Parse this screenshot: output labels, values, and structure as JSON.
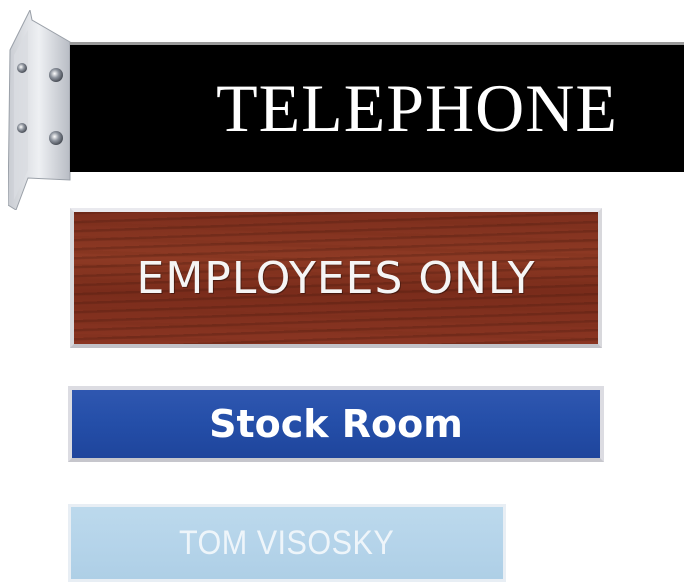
{
  "signs": {
    "telephone": {
      "text": "TELEPHONE",
      "background": "#000000",
      "text_color": "#ffffff"
    },
    "employees": {
      "text": "EMPLOYEES ONLY",
      "background": "#7d2e1d",
      "text_color": "#f5f5f5"
    },
    "stock": {
      "text": "Stock Room",
      "background": "#244ea8",
      "text_color": "#ffffff"
    },
    "tom": {
      "text": "TOM VISOSKY",
      "background": "#b5d4ea",
      "text_color": "#eef5fa"
    }
  }
}
